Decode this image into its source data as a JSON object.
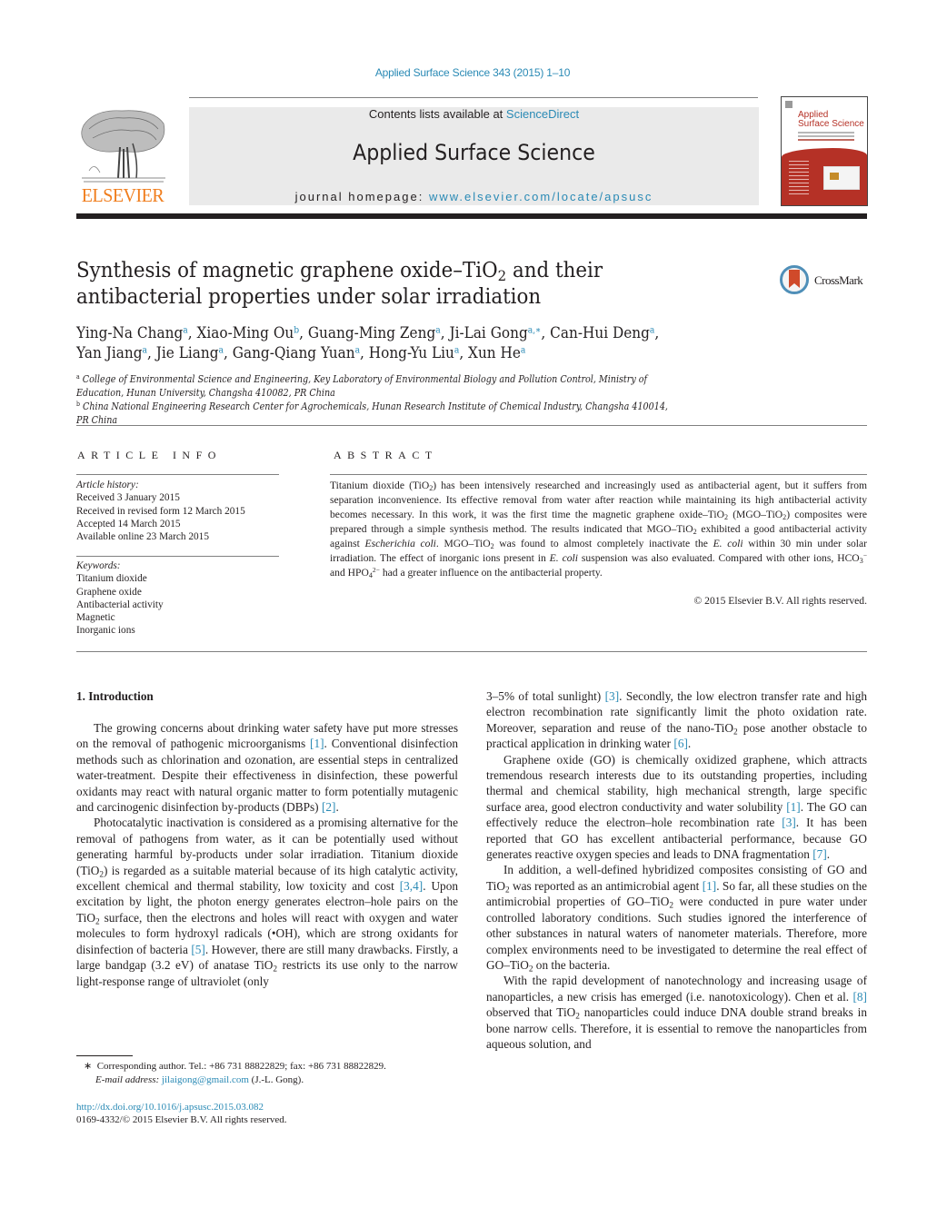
{
  "header": {
    "journal_ref": "Applied Surface Science 343 (2015) 1–10",
    "contents_prefix": "Contents lists available at ",
    "contents_link": "ScienceDirect",
    "journal_name": "Applied Surface Science",
    "homepage_prefix": "journal homepage: ",
    "homepage_link": "www.elsevier.com/locate/apsusc",
    "publisher_logo_text": "ELSEVIER",
    "cover_title_line1": "Applied",
    "cover_title_line2": "Surface Science"
  },
  "article": {
    "title_part1": "Synthesis of magnetic graphene oxide–TiO",
    "title_sub": "2",
    "title_part2": " and their antibacterial properties under solar irradiation",
    "crossmark_label": "CrossMark",
    "authors": [
      {
        "name": "Ying-Na Chang",
        "aff": "a"
      },
      {
        "name": "Xiao-Ming Ou",
        "aff": "b"
      },
      {
        "name": "Guang-Ming Zeng",
        "aff": "a"
      },
      {
        "name": "Ji-Lai Gong",
        "aff": "a,∗"
      },
      {
        "name": "Can-Hui Deng",
        "aff": "a"
      },
      {
        "name": "Yan Jiang",
        "aff": "a"
      },
      {
        "name": "Jie Liang",
        "aff": "a"
      },
      {
        "name": "Gang-Qiang Yuan",
        "aff": "a"
      },
      {
        "name": "Hong-Yu Liu",
        "aff": "a"
      },
      {
        "name": "Xun He",
        "aff": "a"
      }
    ],
    "affiliations": [
      {
        "mark": "a",
        "text": "College of Environmental Science and Engineering, Key Laboratory of Environmental Biology and Pollution Control, Ministry of Education, Hunan University, Changsha 410082, PR China"
      },
      {
        "mark": "b",
        "text": "China National Engineering Research Center for Agrochemicals, Hunan Research Institute of Chemical Industry, Changsha 410014, PR China"
      }
    ]
  },
  "article_info": {
    "heading": "ARTICLE INFO",
    "history_label": "Article history:",
    "history": [
      "Received 3 January 2015",
      "Received in revised form 12 March 2015",
      "Accepted 14 March 2015",
      "Available online 23 March 2015"
    ],
    "keywords_label": "Keywords:",
    "keywords": [
      "Titanium dioxide",
      "Graphene oxide",
      "Antibacterial activity",
      "Magnetic",
      "Inorganic ions"
    ]
  },
  "abstract": {
    "heading": "ABSTRACT",
    "segments": [
      {
        "t": "Titanium dioxide (TiO"
      },
      {
        "sub": "2"
      },
      {
        "t": ") has been intensively researched and increasingly used as antibacterial agent, but it suffers from separation inconvenience. Its effective removal from water after reaction while maintaining its high antibacterial activity becomes necessary. In this work, it was the first time the magnetic graphene oxide–TiO"
      },
      {
        "sub": "2"
      },
      {
        "t": " (MGO–TiO"
      },
      {
        "sub": "2"
      },
      {
        "t": ") composites were prepared through a simple synthesis method. The results indicated that MGO–TiO"
      },
      {
        "sub": "2"
      },
      {
        "t": " exhibited a good antibacterial activity against "
      },
      {
        "i": "Escherichia coli"
      },
      {
        "t": ". MGO–TiO"
      },
      {
        "sub": "2"
      },
      {
        "t": " was found to almost completely inactivate the "
      },
      {
        "i": "E. coli"
      },
      {
        "t": " within 30 min under solar irradiation. The effect of inorganic ions present in "
      },
      {
        "i": "E. coli"
      },
      {
        "t": " suspension was also evaluated. Compared with other ions, HCO"
      },
      {
        "sub": "3"
      },
      {
        "sup": "−"
      },
      {
        "t": " and HPO"
      },
      {
        "sub": "4"
      },
      {
        "sup": "2−"
      },
      {
        "t": " had a greater influence on the antibacterial property."
      }
    ],
    "copyright": "© 2015 Elsevier B.V. All rights reserved."
  },
  "introduction": {
    "heading": "1.  Introduction",
    "left_paragraphs": [
      [
        {
          "t": "The growing concerns about drinking water safety have put more stresses on the removal of pathogenic microorganisms "
        },
        {
          "ref": "[1]"
        },
        {
          "t": ". Conventional disinfection methods such as chlorination and ozonation, are essential steps in centralized water-treatment. Despite their effectiveness in disinfection, these powerful oxidants may react with natural organic matter to form potentially mutagenic and carcinogenic disinfection by-products (DBPs) "
        },
        {
          "ref": "[2]"
        },
        {
          "t": "."
        }
      ],
      [
        {
          "t": "Photocatalytic inactivation is considered as a promising alternative for the removal of pathogens from water, as it can be potentially used without generating harmful by-products under solar irradiation. Titanium dioxide (TiO"
        },
        {
          "sub": "2"
        },
        {
          "t": ") is regarded as a suitable material because of its high catalytic activity, excellent chemical and thermal stability, low toxicity and cost "
        },
        {
          "ref": "[3,4]"
        },
        {
          "t": ". Upon excitation by light, the photon energy generates electron–hole pairs on the TiO"
        },
        {
          "sub": "2"
        },
        {
          "t": " surface, then the electrons and holes will react with oxygen and water molecules to form hydroxyl radicals (•OH), which are strong oxidants for disinfection of bacteria "
        },
        {
          "ref": "[5]"
        },
        {
          "t": ". However, there are still many drawbacks. Firstly, a large bandgap (3.2 eV) of anatase TiO"
        },
        {
          "sub": "2"
        },
        {
          "t": " restricts its use only to the narrow light-response range of ultraviolet (only"
        }
      ]
    ],
    "right_paragraphs": [
      [
        {
          "t": "3–5% of total sunlight) "
        },
        {
          "ref": "[3]"
        },
        {
          "t": ". Secondly, the low electron transfer rate and high electron recombination rate significantly limit the photo oxidation rate. Moreover, separation and reuse of the nano-TiO"
        },
        {
          "sub": "2"
        },
        {
          "t": " pose another obstacle to practical application in drinking water "
        },
        {
          "ref": "[6]"
        },
        {
          "t": "."
        }
      ],
      [
        {
          "t": "Graphene oxide (GO) is chemically oxidized graphene, which attracts tremendous research interests due to its outstanding properties, including thermal and chemical stability, high mechanical strength, large specific surface area, good electron conductivity and water solubility "
        },
        {
          "ref": "[1]"
        },
        {
          "t": ". The GO can effectively reduce the electron–hole recombination rate "
        },
        {
          "ref": "[3]"
        },
        {
          "t": ". It has been reported that GO has excellent antibacterial performance, because GO generates reactive oxygen species and leads to DNA fragmentation "
        },
        {
          "ref": "[7]"
        },
        {
          "t": "."
        }
      ],
      [
        {
          "t": "In addition, a well-defined hybridized composites consisting of GO and TiO"
        },
        {
          "sub": "2"
        },
        {
          "t": " was reported as an antimicrobial agent "
        },
        {
          "ref": "[1]"
        },
        {
          "t": ". So far, all these studies on the antimicrobial properties of GO–TiO"
        },
        {
          "sub": "2"
        },
        {
          "t": " were conducted in pure water under controlled laboratory conditions. Such studies ignored the interference of other substances in natural waters of nanometer materials. Therefore, more complex environments need to be investigated to determine the real effect of GO–TiO"
        },
        {
          "sub": "2"
        },
        {
          "t": " on the bacteria."
        }
      ],
      [
        {
          "t": "With the rapid development of nanotechnology and increasing usage of nanoparticles, a new crisis has emerged (i.e. nanotoxicology). Chen et al. "
        },
        {
          "ref": "[8]"
        },
        {
          "t": " observed that TiO"
        },
        {
          "sub": "2"
        },
        {
          "t": " nanoparticles could induce DNA double strand breaks in bone narrow cells. Therefore, it is essential to remove the nanoparticles from aqueous solution, and"
        }
      ]
    ]
  },
  "footnote": {
    "mark": "∗",
    "corresponding": "Corresponding author. Tel.: +86 731 88822829; fax: +86 731 88822829.",
    "email_label": "E-mail address:",
    "email": "jilaigong@gmail.com",
    "email_suffix": " (J.-L. Gong).",
    "doi": "http://dx.doi.org/10.1016/j.apsusc.2015.03.082",
    "issn_line": "0169-4332/© 2015 Elsevier B.V. All rights reserved."
  },
  "colors": {
    "link": "#2a8ab5",
    "elsevier_orange": "#f07d1c",
    "cover_red": "#b53126",
    "banner_gray": "#eaeaea",
    "text": "#231f20"
  }
}
